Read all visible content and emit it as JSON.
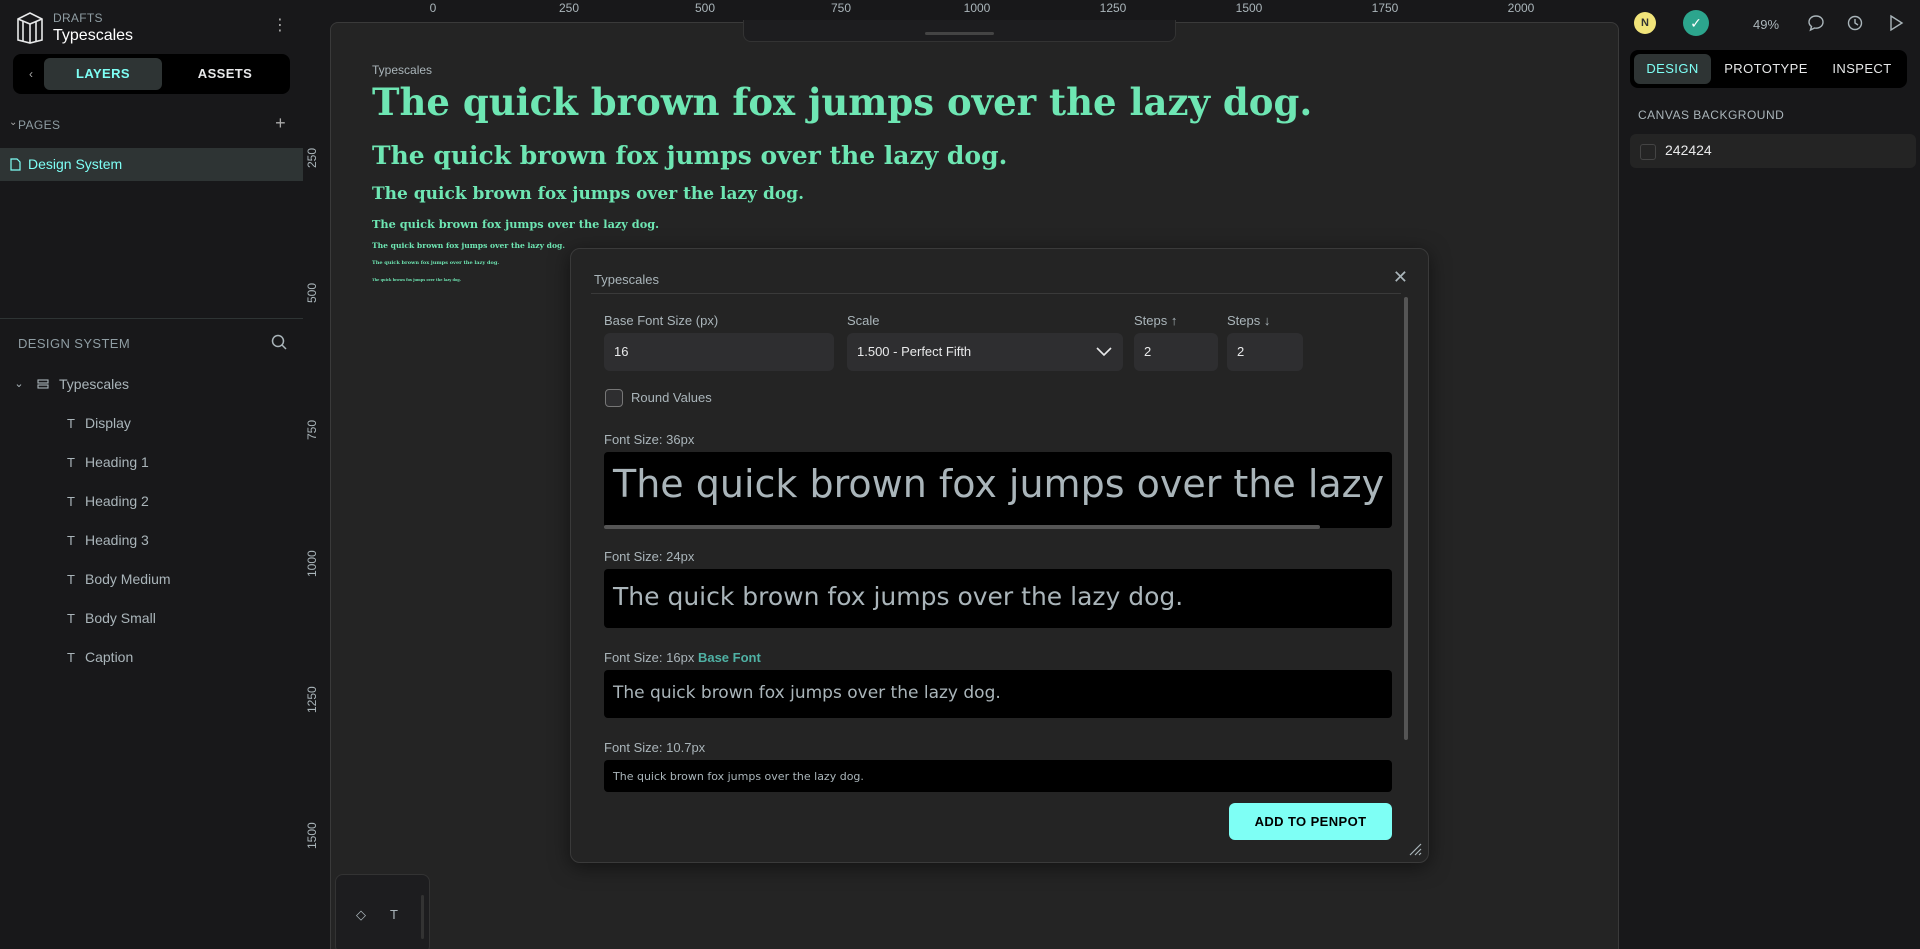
{
  "project": {
    "team": "DRAFTS",
    "name": "Typescales"
  },
  "left_tabs": {
    "layers": "LAYERS",
    "assets": "ASSETS"
  },
  "pages": {
    "title": "PAGES",
    "items": [
      "Design System"
    ]
  },
  "design_system": {
    "title": "DESIGN SYSTEM",
    "group": "Typescales",
    "layers": [
      "Display",
      "Heading 1",
      "Heading 2",
      "Heading 3",
      "Body Medium",
      "Body Small",
      "Caption"
    ]
  },
  "rulers": {
    "top": [
      "0",
      "250",
      "500",
      "750",
      "1000",
      "1250",
      "1500",
      "1750",
      "2000"
    ],
    "left": [
      "250",
      "500",
      "750",
      "1000",
      "1250",
      "1500"
    ]
  },
  "board": {
    "title": "Typescales",
    "sample_text": "The quick brown fox jumps over the lazy dog."
  },
  "dialog": {
    "title": "Typescales",
    "base_font_label": "Base Font Size (px)",
    "base_font_value": "16",
    "scale_label": "Scale",
    "scale_value": "1.500 - Perfect Fifth",
    "steps_up_label": "Steps ↑",
    "steps_up_value": "2",
    "steps_down_label": "Steps ↓",
    "steps_down_value": "2",
    "round_label": "Round Values",
    "previews": [
      {
        "label": "Font Size: 36px",
        "text": "The quick brown fox jumps over the lazy dog."
      },
      {
        "label": "Font Size: 24px",
        "text": "The quick brown fox jumps over the lazy dog."
      },
      {
        "label": "Font Size: 16px",
        "badge": "Base Font",
        "text": "The quick brown fox jumps over the lazy dog."
      },
      {
        "label": "Font Size: 10.7px",
        "text": "The quick brown fox jumps over the lazy dog."
      }
    ],
    "add_button": "ADD TO PENPOT"
  },
  "toolbar": {
    "tool1": "◇",
    "tool2": "T"
  },
  "right": {
    "avatar_initial": "N",
    "zoom": "49%",
    "tabs": [
      "DESIGN",
      "PROTOTYPE",
      "INSPECT"
    ],
    "canvas_bg_title": "CANVAS BACKGROUND",
    "canvas_bg_value": "242424"
  },
  "colors": {
    "accent": "#7efff5",
    "sample_text": "#6ee6b3",
    "canvas_bg": "#242424",
    "app_bg": "#18181a"
  }
}
